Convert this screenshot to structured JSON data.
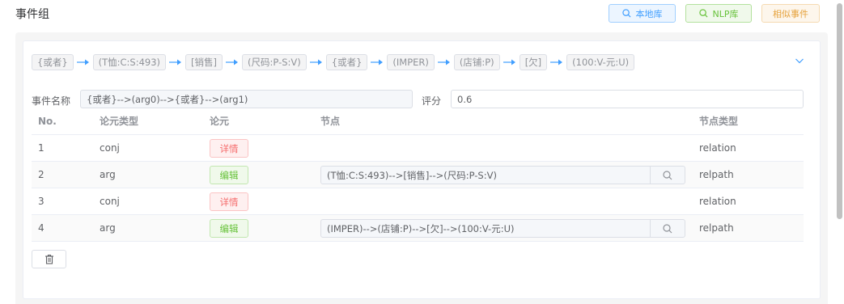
{
  "header": {
    "title": "事件组"
  },
  "toolbar": {
    "local_label": "本地库",
    "nlp_label": "NLP库",
    "similar_label": "相似事件"
  },
  "chain": {
    "nodes": [
      "{或者}",
      "(T恤:C:S:493)",
      "[销售]",
      "(尺码:P-S:V)",
      "{或者}",
      "(IMPER)",
      "(店铺:P)",
      "[欠]",
      "(100:V-元:U)"
    ]
  },
  "form": {
    "name_label": "事件名称",
    "name_value": "{或者}-->(arg0)-->{或者}-->(arg1)",
    "score_label": "评分",
    "score_value": "0.6"
  },
  "table": {
    "headers": {
      "no": "No.",
      "type": "论元类型",
      "arg": "论元",
      "node": "节点",
      "node_type": "节点类型"
    },
    "rows": [
      {
        "no": "1",
        "type": "conj",
        "action": "详情",
        "node": "",
        "node_type": "relation"
      },
      {
        "no": "2",
        "type": "arg",
        "action": "编辑",
        "node": "(T恤:C:S:493)-->[销售]-->(尺码:P-S:V)",
        "node_type": "relpath"
      },
      {
        "no": "3",
        "type": "conj",
        "action": "详情",
        "node": "",
        "node_type": "relation"
      },
      {
        "no": "4",
        "type": "arg",
        "action": "编辑",
        "node": "(IMPER)-->(店铺:P)-->[欠]-->(100:V-元:U)",
        "node_type": "relpath"
      }
    ]
  },
  "colors": {
    "primary": "#409eff",
    "success": "#67c23a",
    "warning": "#e6a23c",
    "danger": "#f56c6c"
  }
}
